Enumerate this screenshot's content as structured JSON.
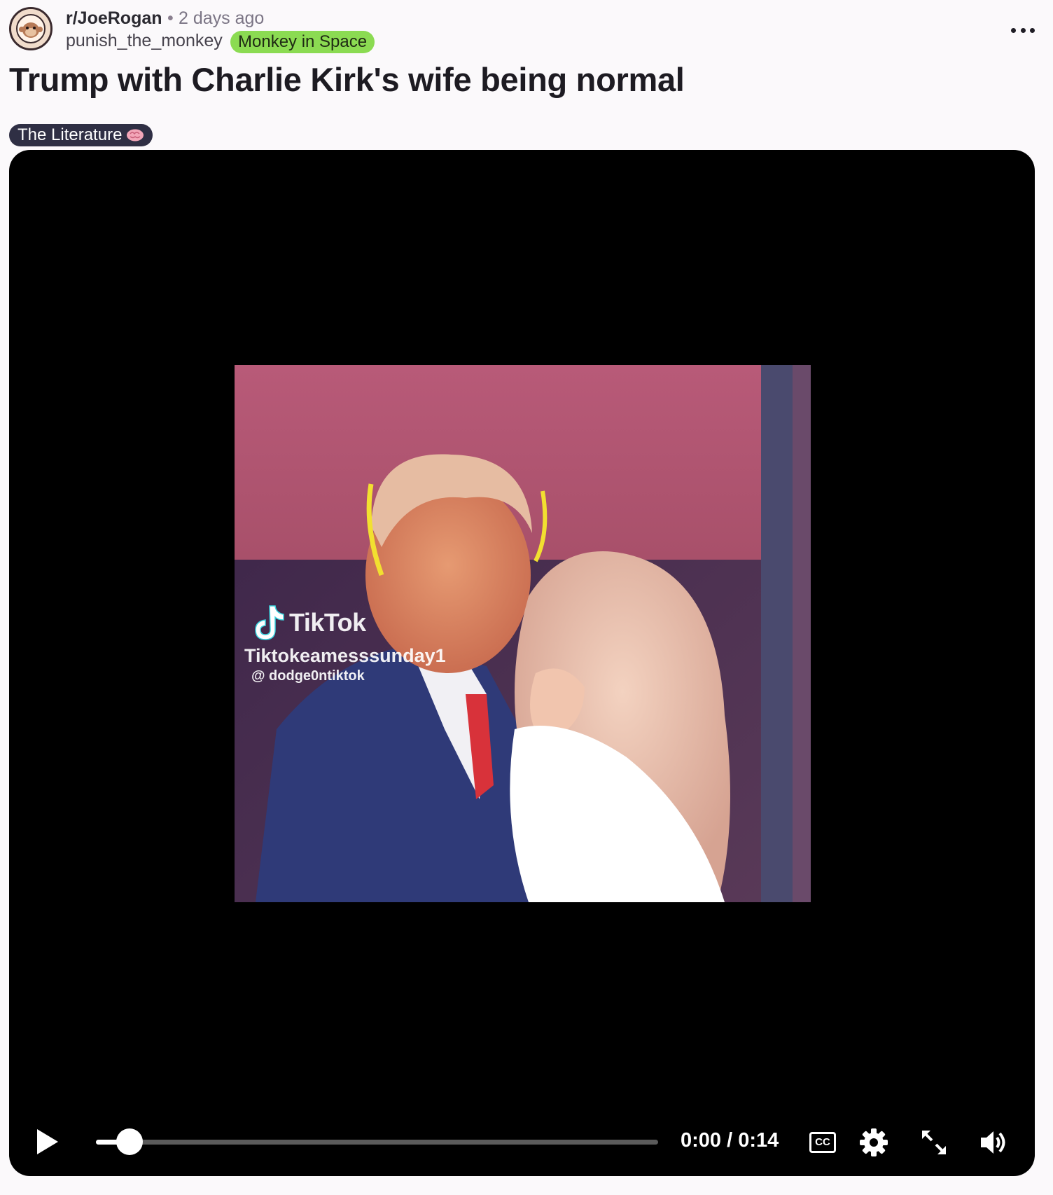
{
  "header": {
    "subreddit": "r/JoeRogan",
    "separator": "•",
    "time_ago": "2 days ago",
    "username": "punish_the_monkey",
    "user_flair": "Monkey in Space",
    "user_flair_color": "#8bdb52",
    "more_icon": "more-horizontal-icon",
    "avatar_icon": "joe-rogan-experience-monkey-logo"
  },
  "post": {
    "title": "Trump with Charlie Kirk's wife being normal",
    "flair_label": "The Literature",
    "flair_icon": "brain-icon",
    "flair_color": "#2f2f44"
  },
  "video": {
    "watermark_brand": "TikTok",
    "watermark_handle_overlap": "Tiktokeamesssunday1",
    "watermark_handle": "@ dodge0ntiktok",
    "current_time": "0:00",
    "duration": "0:14",
    "time_display": "0:00 / 0:14",
    "progress_fraction": 0.06,
    "controls": {
      "play_icon": "play-icon",
      "cc_label": "CC",
      "settings_icon": "gear-icon",
      "fullscreen_icon": "expand-icon",
      "volume_icon": "volume-icon"
    }
  }
}
